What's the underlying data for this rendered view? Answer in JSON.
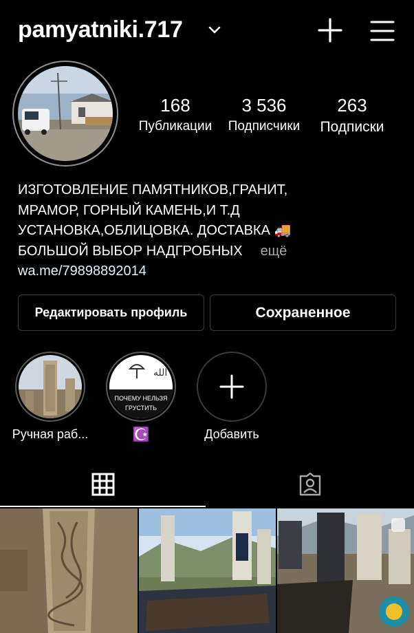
{
  "header": {
    "username": "pamyatniki.717",
    "chevron_icon": "chevron-down-icon",
    "new_post_icon": "plus-icon",
    "menu_icon": "hamburger-menu-icon"
  },
  "stats": [
    {
      "value": "168",
      "label": "Публикации"
    },
    {
      "value": "3 536",
      "label": "Подписчики"
    },
    {
      "value": "263",
      "label": "Подписки"
    }
  ],
  "bio": {
    "lines": [
      "ИЗГОТОВЛЕНИЕ ПАМЯТНИКОВ,ГРАНИТ,",
      "МРАМОР, ГОРНЫЙ КАМЕНЬ,И Т.Д",
      "УСТАНОВКА,ОБЛИЦОВКА. ДОСТАВКА 🚚",
      "БОЛЬШОЙ ВЫБОР НАДГРОБНЫХ"
    ],
    "more": "ещё",
    "link": "wa.me/79898892014"
  },
  "buttons": {
    "edit_profile": "Редактировать профиль",
    "saved": "Сохраненное"
  },
  "highlights": [
    {
      "label": "Ручная раб..."
    },
    {
      "label": "☪️",
      "image_text_1": "ПОЧЕМУ НЕЛЬЗЯ",
      "image_text_2": "ГРУСТИТЬ"
    },
    {
      "label": "Добавить"
    }
  ],
  "tabs": [
    {
      "icon": "grid-icon",
      "active": true
    },
    {
      "icon": "tagged-person-icon",
      "active": false
    }
  ],
  "colors": {
    "background": "#000000",
    "text": "#ffffff",
    "muted": "#a8a8a8",
    "link": "#e0f1ff",
    "border": "#3a3a3a"
  }
}
